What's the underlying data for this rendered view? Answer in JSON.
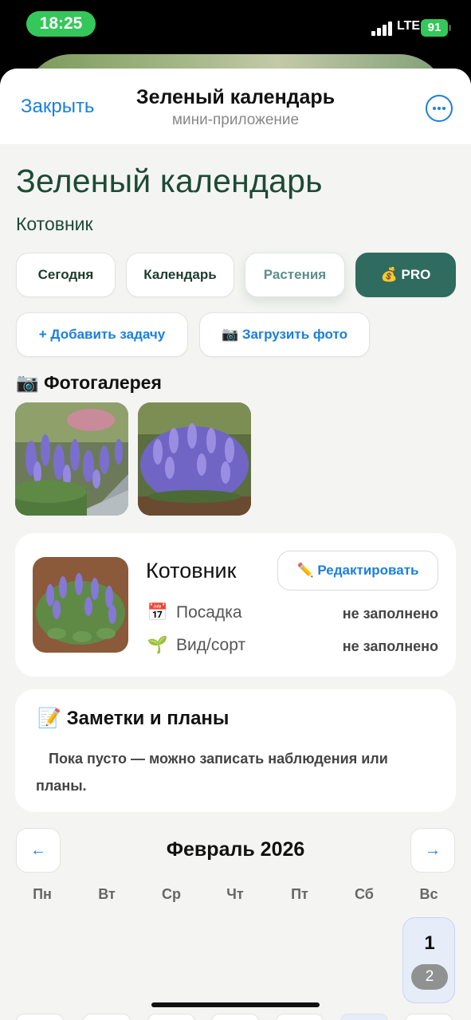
{
  "status": {
    "time": "18:25",
    "network": "LTE",
    "battery": "91"
  },
  "nav": {
    "close": "Закрыть",
    "title": "Зеленый календарь",
    "subtitle": "мини-приложение"
  },
  "page": {
    "title": "Зеленый календарь",
    "plant": "Котовник"
  },
  "tabs": [
    {
      "label": "Сегодня"
    },
    {
      "label": "Календарь"
    },
    {
      "label": "Растения"
    },
    {
      "icon": "💰",
      "label": "PRO"
    }
  ],
  "actions": {
    "add_task": "+ Добавить задачу",
    "upload_icon": "📷",
    "upload_photo": "Загрузить фото"
  },
  "gallery": {
    "icon": "📷",
    "title": "Фотогалерея"
  },
  "plant_card": {
    "name": "Котовник",
    "edit_icon": "✏️",
    "edit": "Редактировать",
    "rows": [
      {
        "icon": "📅",
        "label": "Посадка",
        "value": "не заполнено"
      },
      {
        "icon": "🌱",
        "label": "Вид/сорт",
        "value": "не заполнено"
      }
    ]
  },
  "notes": {
    "icon": "📝",
    "title": "Заметки и планы",
    "body": "Пока пусто — можно записать наблюдения или планы."
  },
  "calendar": {
    "prev": "←",
    "next": "→",
    "month": "Февраль 2026",
    "weekdays": [
      "Пн",
      "Вт",
      "Ср",
      "Чт",
      "Пт",
      "Сб",
      "Вс"
    ],
    "first_day": "1",
    "first_day_badge": "2"
  },
  "colors": {
    "accent": "#1a7fe0",
    "brand": "#2f6b5f",
    "heading": "#1d4a36"
  }
}
